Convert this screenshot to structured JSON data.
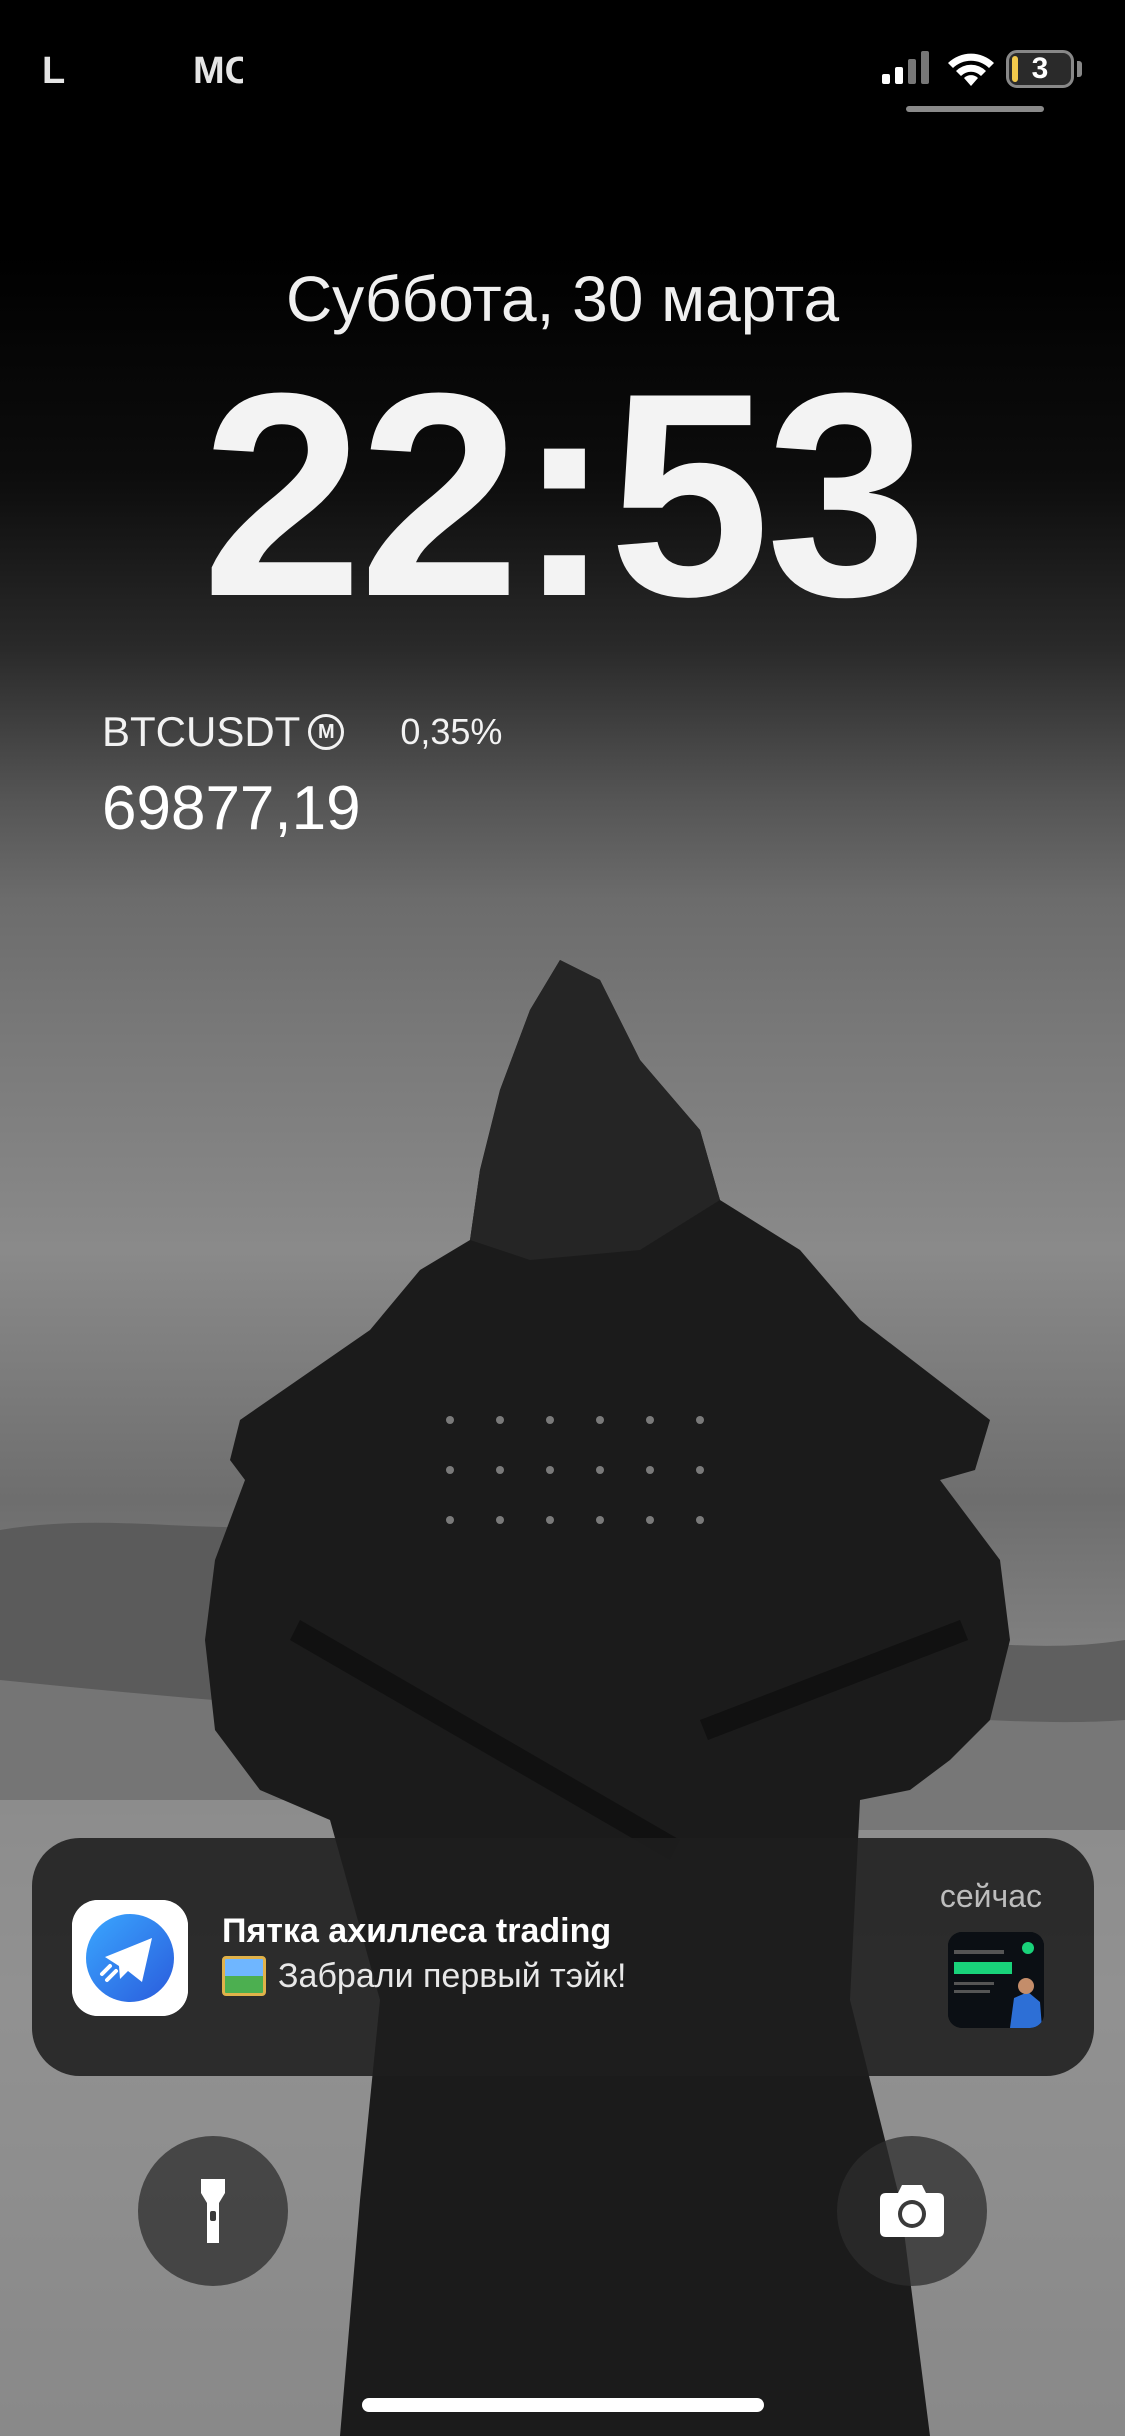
{
  "status_bar": {
    "carrier_left": "L",
    "carrier_mid": "MC",
    "battery_level": "3",
    "battery_fraction": 0.03
  },
  "lock_screen": {
    "date": "Суббота, 30 марта",
    "time": "22:53"
  },
  "widget": {
    "symbol": "BTCUSDT",
    "badge": "M",
    "change": "0,35%",
    "price": "69877,19"
  },
  "notification": {
    "app_icon": "telegram-icon",
    "title": "Пятка ахиллеса trading",
    "body": "Забрали первый тэйк!",
    "time": "сейчас"
  },
  "controls": {
    "flashlight_icon": "flashlight-icon",
    "camera_icon": "camera-icon"
  }
}
